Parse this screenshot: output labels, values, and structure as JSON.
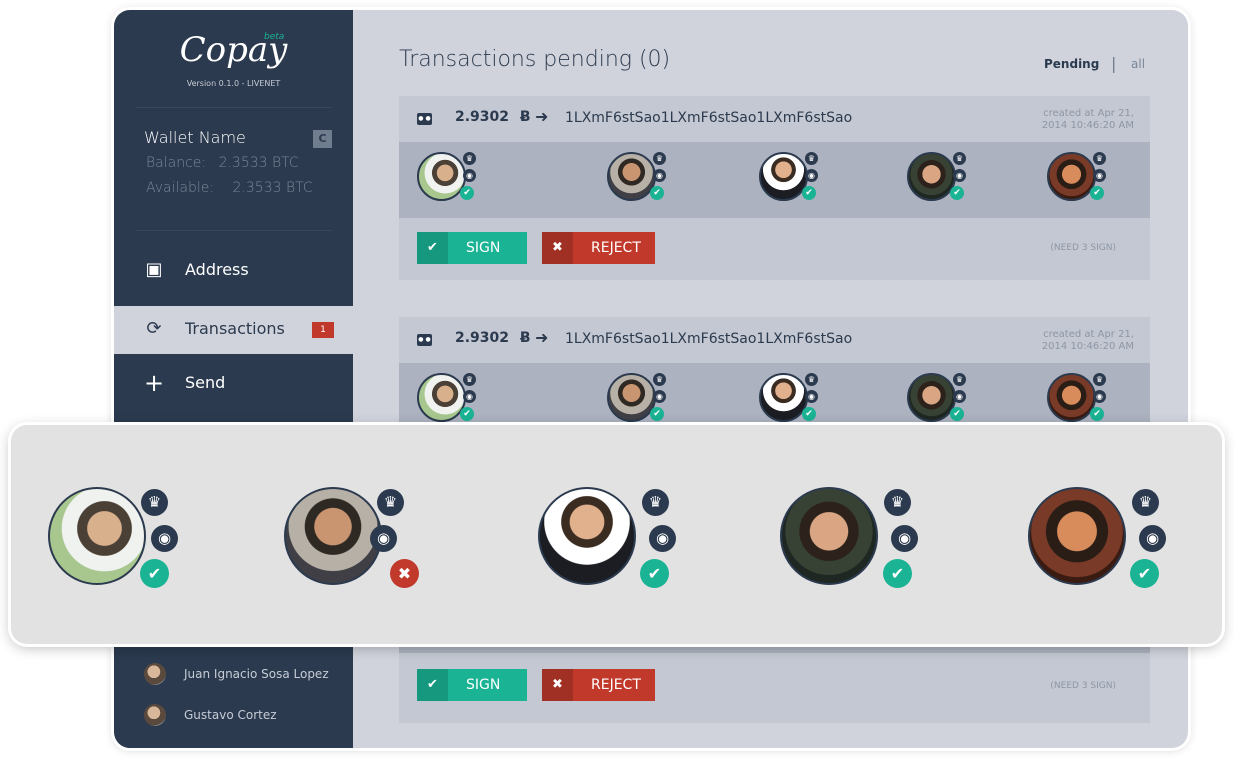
{
  "app": {
    "logo": "Copay",
    "beta": "beta",
    "version": "Version 0.1.0 - LIVENET"
  },
  "wallet": {
    "name": "Wallet Name",
    "balance_label": "Balance:",
    "balance_value": "2.3533 BTC",
    "available_label": "Available:",
    "available_value": "2.3533 BTC"
  },
  "nav": {
    "address": "Address",
    "transactions": "Transactions",
    "transactions_badge": "1",
    "send": "Send"
  },
  "contacts": [
    {
      "name": "Juan Ignacio Sosa Lopez"
    },
    {
      "name": "Gustavo Cortez"
    }
  ],
  "main": {
    "title": "Transactions pending (0)",
    "filter_pending": "Pending",
    "filter_separator": "|",
    "filter_all": "all"
  },
  "transactions": [
    {
      "amount": "2.9302",
      "currency_symbol": "Ƀ",
      "address": "1LXmF6stSao1LXmF6stSao1LXmF6stSao",
      "created_line1": "created at Apr 21,",
      "created_line2": "2014 10:46:20 AM",
      "sign_label": "SIGN",
      "reject_label": "REJECT",
      "need": "(NEED 3 SIGN)"
    },
    {
      "amount": "2.9302",
      "currency_symbol": "Ƀ",
      "address": "1LXmF6stSao1LXmF6stSao1LXmF6stSao",
      "created_line1": "created at Apr 21,",
      "created_line2": "2014 10:46:20 AM",
      "sign_label": "SIGN",
      "reject_label": "REJECT",
      "need": "(NEED 3 SIGN)"
    }
  ],
  "copayers_zoom": [
    {
      "status": "signed"
    },
    {
      "status": "rejected"
    },
    {
      "status": "signed"
    },
    {
      "status": "signed"
    },
    {
      "status": "signed"
    }
  ],
  "icons": {
    "crown": "crown-icon",
    "eye": "eye-icon",
    "check": "✔",
    "cross": "✖"
  },
  "colors": {
    "sidebar": "#2b3a4e",
    "main_bg": "#d0d3dc",
    "sign": "#1ab394",
    "reject": "#c0392b"
  }
}
